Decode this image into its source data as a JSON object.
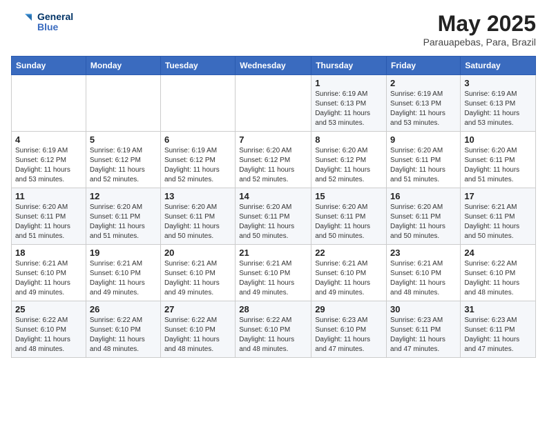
{
  "logo": {
    "text_general": "General",
    "text_blue": "Blue"
  },
  "header": {
    "month": "May 2025",
    "location": "Parauapebas, Para, Brazil"
  },
  "weekdays": [
    "Sunday",
    "Monday",
    "Tuesday",
    "Wednesday",
    "Thursday",
    "Friday",
    "Saturday"
  ],
  "weeks": [
    [
      {
        "day": "",
        "info": ""
      },
      {
        "day": "",
        "info": ""
      },
      {
        "day": "",
        "info": ""
      },
      {
        "day": "",
        "info": ""
      },
      {
        "day": "1",
        "info": "Sunrise: 6:19 AM\nSunset: 6:13 PM\nDaylight: 11 hours\nand 53 minutes."
      },
      {
        "day": "2",
        "info": "Sunrise: 6:19 AM\nSunset: 6:13 PM\nDaylight: 11 hours\nand 53 minutes."
      },
      {
        "day": "3",
        "info": "Sunrise: 6:19 AM\nSunset: 6:13 PM\nDaylight: 11 hours\nand 53 minutes."
      }
    ],
    [
      {
        "day": "4",
        "info": "Sunrise: 6:19 AM\nSunset: 6:12 PM\nDaylight: 11 hours\nand 53 minutes."
      },
      {
        "day": "5",
        "info": "Sunrise: 6:19 AM\nSunset: 6:12 PM\nDaylight: 11 hours\nand 52 minutes."
      },
      {
        "day": "6",
        "info": "Sunrise: 6:19 AM\nSunset: 6:12 PM\nDaylight: 11 hours\nand 52 minutes."
      },
      {
        "day": "7",
        "info": "Sunrise: 6:20 AM\nSunset: 6:12 PM\nDaylight: 11 hours\nand 52 minutes."
      },
      {
        "day": "8",
        "info": "Sunrise: 6:20 AM\nSunset: 6:12 PM\nDaylight: 11 hours\nand 52 minutes."
      },
      {
        "day": "9",
        "info": "Sunrise: 6:20 AM\nSunset: 6:11 PM\nDaylight: 11 hours\nand 51 minutes."
      },
      {
        "day": "10",
        "info": "Sunrise: 6:20 AM\nSunset: 6:11 PM\nDaylight: 11 hours\nand 51 minutes."
      }
    ],
    [
      {
        "day": "11",
        "info": "Sunrise: 6:20 AM\nSunset: 6:11 PM\nDaylight: 11 hours\nand 51 minutes."
      },
      {
        "day": "12",
        "info": "Sunrise: 6:20 AM\nSunset: 6:11 PM\nDaylight: 11 hours\nand 51 minutes."
      },
      {
        "day": "13",
        "info": "Sunrise: 6:20 AM\nSunset: 6:11 PM\nDaylight: 11 hours\nand 50 minutes."
      },
      {
        "day": "14",
        "info": "Sunrise: 6:20 AM\nSunset: 6:11 PM\nDaylight: 11 hours\nand 50 minutes."
      },
      {
        "day": "15",
        "info": "Sunrise: 6:20 AM\nSunset: 6:11 PM\nDaylight: 11 hours\nand 50 minutes."
      },
      {
        "day": "16",
        "info": "Sunrise: 6:20 AM\nSunset: 6:11 PM\nDaylight: 11 hours\nand 50 minutes."
      },
      {
        "day": "17",
        "info": "Sunrise: 6:21 AM\nSunset: 6:11 PM\nDaylight: 11 hours\nand 50 minutes."
      }
    ],
    [
      {
        "day": "18",
        "info": "Sunrise: 6:21 AM\nSunset: 6:10 PM\nDaylight: 11 hours\nand 49 minutes."
      },
      {
        "day": "19",
        "info": "Sunrise: 6:21 AM\nSunset: 6:10 PM\nDaylight: 11 hours\nand 49 minutes."
      },
      {
        "day": "20",
        "info": "Sunrise: 6:21 AM\nSunset: 6:10 PM\nDaylight: 11 hours\nand 49 minutes."
      },
      {
        "day": "21",
        "info": "Sunrise: 6:21 AM\nSunset: 6:10 PM\nDaylight: 11 hours\nand 49 minutes."
      },
      {
        "day": "22",
        "info": "Sunrise: 6:21 AM\nSunset: 6:10 PM\nDaylight: 11 hours\nand 49 minutes."
      },
      {
        "day": "23",
        "info": "Sunrise: 6:21 AM\nSunset: 6:10 PM\nDaylight: 11 hours\nand 48 minutes."
      },
      {
        "day": "24",
        "info": "Sunrise: 6:22 AM\nSunset: 6:10 PM\nDaylight: 11 hours\nand 48 minutes."
      }
    ],
    [
      {
        "day": "25",
        "info": "Sunrise: 6:22 AM\nSunset: 6:10 PM\nDaylight: 11 hours\nand 48 minutes."
      },
      {
        "day": "26",
        "info": "Sunrise: 6:22 AM\nSunset: 6:10 PM\nDaylight: 11 hours\nand 48 minutes."
      },
      {
        "day": "27",
        "info": "Sunrise: 6:22 AM\nSunset: 6:10 PM\nDaylight: 11 hours\nand 48 minutes."
      },
      {
        "day": "28",
        "info": "Sunrise: 6:22 AM\nSunset: 6:10 PM\nDaylight: 11 hours\nand 48 minutes."
      },
      {
        "day": "29",
        "info": "Sunrise: 6:23 AM\nSunset: 6:10 PM\nDaylight: 11 hours\nand 47 minutes."
      },
      {
        "day": "30",
        "info": "Sunrise: 6:23 AM\nSunset: 6:11 PM\nDaylight: 11 hours\nand 47 minutes."
      },
      {
        "day": "31",
        "info": "Sunrise: 6:23 AM\nSunset: 6:11 PM\nDaylight: 11 hours\nand 47 minutes."
      }
    ]
  ]
}
